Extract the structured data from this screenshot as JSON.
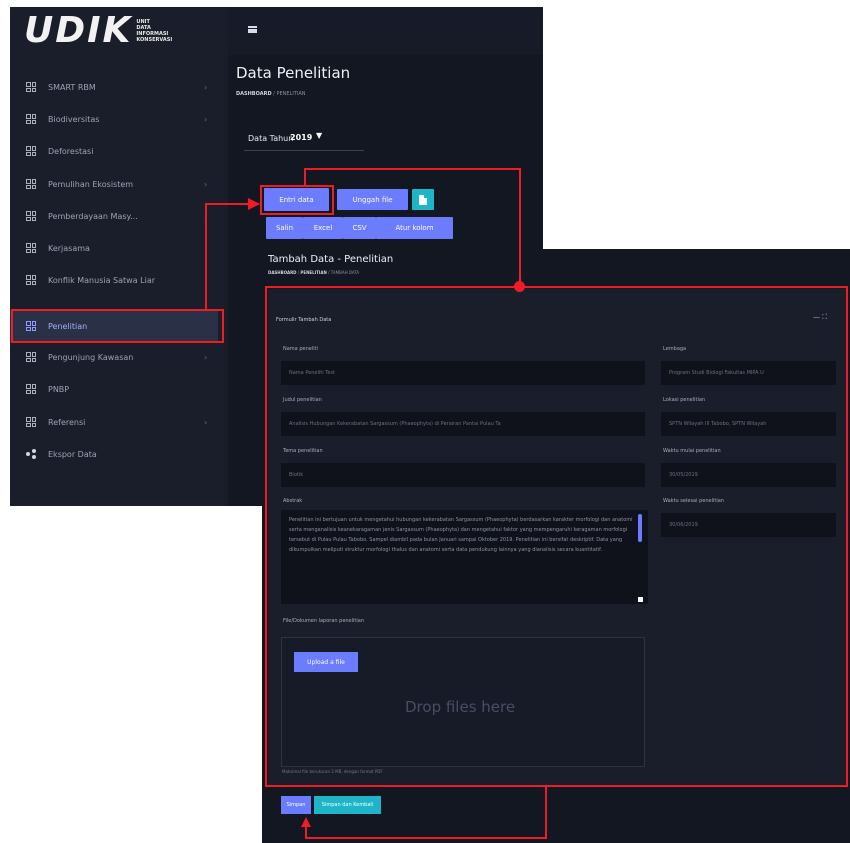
{
  "logo": {
    "word": "UDIK",
    "subtitle": [
      "UNIT",
      "DATA",
      "INFORMASI",
      "KONSERVASI"
    ]
  },
  "sidebar": {
    "items": [
      {
        "label": "SMART RBM",
        "chevron": true
      },
      {
        "label": "Biodiversitas",
        "chevron": true
      },
      {
        "label": "Deforestasi",
        "chevron": false
      },
      {
        "label": "Pemulihan Ekosistem",
        "chevron": true
      },
      {
        "label": "Pemberdayaan Masy...",
        "chevron": true
      },
      {
        "label": "Kerjasama",
        "chevron": false
      },
      {
        "label": "Konflik Manusia Satwa Liar",
        "chevron": false
      },
      {
        "label": "Penelitian",
        "chevron": false,
        "active": true
      },
      {
        "label": "Pengunjung Kawasan",
        "chevron": true
      },
      {
        "label": "PNBP",
        "chevron": false
      },
      {
        "label": "Referensi",
        "chevron": true
      },
      {
        "label": "Ekspor Data",
        "chevron": false
      }
    ]
  },
  "header": {
    "menu_icon": "hamburger-icon"
  },
  "page": {
    "title": "Data Penelitian",
    "breadcrumb": {
      "home": "DASHBOARD",
      "sep": "/",
      "current": "PENELITIAN"
    },
    "year_label": "Data Tahun",
    "year_value": "2019"
  },
  "toolbar": {
    "add": "Entri data",
    "upload": "Unggah file",
    "file_icon": "file-icon",
    "salin": "Salin",
    "excel": "Excel",
    "csv": "CSV",
    "columns": "Atur kolom"
  },
  "add_page": {
    "title": "Tambah Data - Penelitian",
    "breadcrumb": {
      "home": "DASHBOARD",
      "sep1": "/",
      "middle": "PENELITIAN",
      "sep2": "/",
      "current": "TAMBAH DATA"
    }
  },
  "form": {
    "title": "Formulir Tambah Data",
    "collapse": "—",
    "expand": "⛶",
    "nama_peneliti": {
      "label": "Nama peneliti",
      "value": "Nama Peneliti Test"
    },
    "lembaga": {
      "label": "Lembaga",
      "value": "Program Studi Biologi Fakultas MIPA U"
    },
    "judul": {
      "label": "Judul penelitian",
      "value": "Analisis Hubungan Kekerabatan Sargassum (Phaeophyta) di Perairan Pantai Pulau Ta"
    },
    "lokasi": {
      "label": "Lokasi penelitian",
      "value": "SPTN Wilayah III Tabobo, SPTN Wilayah"
    },
    "tema": {
      "label": "Tema penelitian",
      "value": "Biotik"
    },
    "waktu_mulai": {
      "label": "Waktu mulai penelitian",
      "value": "30/05/2019"
    },
    "abstrak": {
      "label": "Abstrak",
      "value": "Penelitian ini bertujuan untuk mengetahui hubungan kekerabatan Sargassum (Phaeophyta) berdasarkan karakter morfologi dan anatomi serta menganalisis keanekaragaman jenis Sargassum (Phaeophyta) dan mengetahui faktor yang mempengaruhi keragaman morfologi tersebut di Pulau Pulau Tabobo. Sampel diambil pada bulan Januari sampai Oktober 2019. Penelitian ini bersifat deskriptif. Data yang dikumpulkan meliputi struktur morfologi thalus dan anatomi serta data pendukung lainnya yang dianalisis secara kuantitatif."
    },
    "waktu_selesai": {
      "label": "Waktu selesai penelitian",
      "value": "30/06/2019"
    },
    "file": {
      "label": "File/Dokumen laporan penelitian",
      "upload_button": "Upload a file",
      "drop_text": "Drop files here",
      "hint": "Maksimal file berukuran 2 MB, dengan format PDF"
    },
    "save": "Simpan",
    "save_back": "Simpan dan Kembali"
  },
  "annotations": {
    "color": "#ee1c25"
  },
  "colors": {
    "accent": "#6c7cff",
    "teal": "#1fb5c9",
    "bg": "#131722"
  }
}
